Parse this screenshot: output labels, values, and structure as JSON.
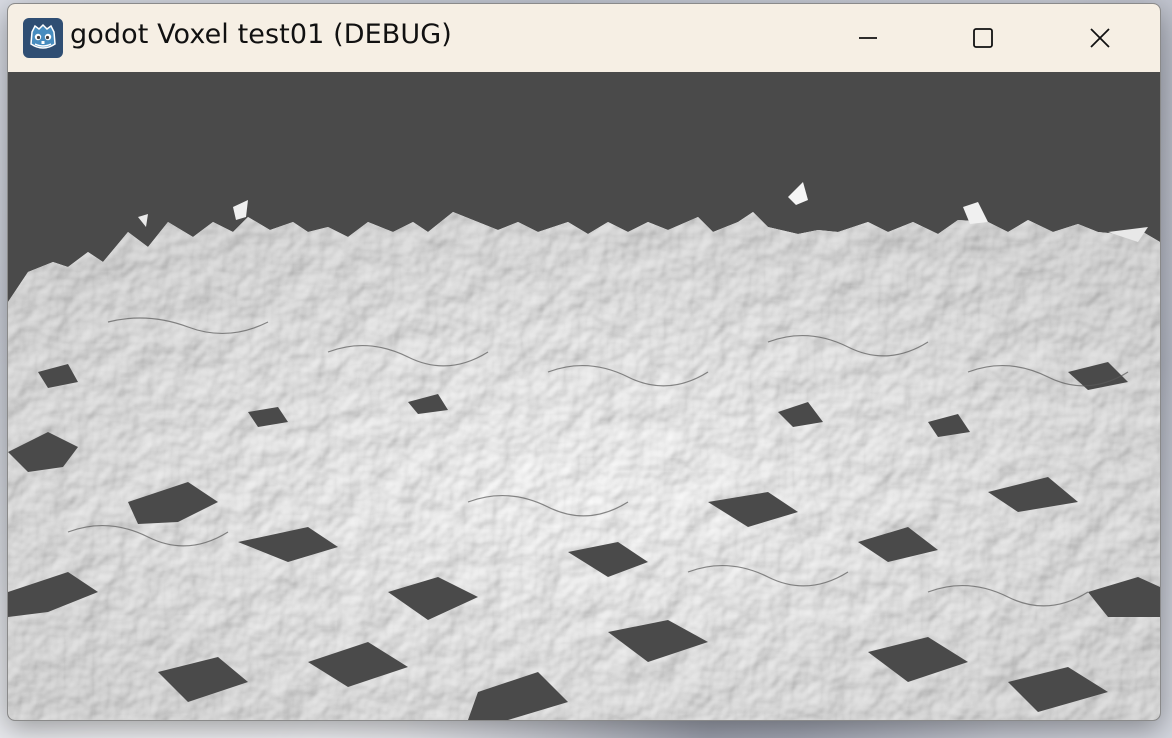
{
  "window": {
    "title": "godot Voxel test01 (DEBUG)",
    "app_icon": "godot-icon"
  },
  "title_controls": {
    "minimize_icon": "minimize-icon",
    "maximize_icon": "maximize-icon",
    "close_icon": "close-icon"
  },
  "viewport": {
    "description_icon": "voxel-terrain-render",
    "background_color": "#4a4a4a",
    "terrain_color": "#f0f0f0"
  }
}
